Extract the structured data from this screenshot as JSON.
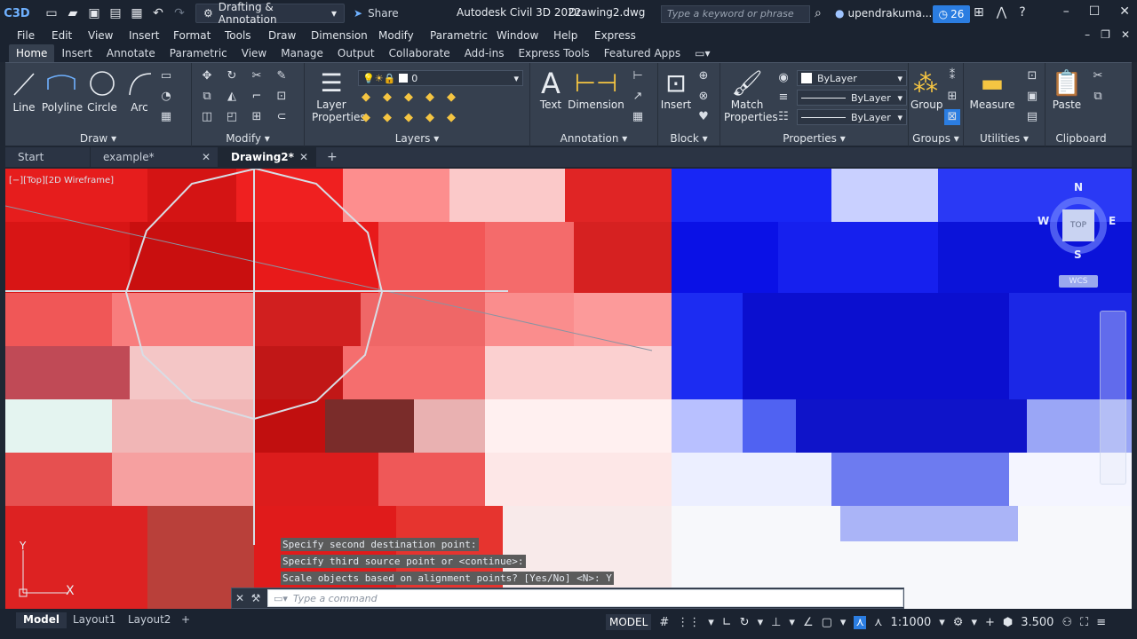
{
  "titlebar": {
    "logo": "C3D",
    "workspace": "Drafting & Annotation",
    "share": "Share",
    "app_name": "Autodesk Civil 3D 2022",
    "file_name": "Drawing2.dwg",
    "search_placeholder": "Type a keyword or phrase",
    "user": "upendrakuma...",
    "clock_count": "26"
  },
  "menu": [
    "File",
    "Edit",
    "View",
    "Insert",
    "Format",
    "Tools",
    "Draw",
    "Dimension",
    "Modify",
    "Parametric",
    "Window",
    "Help",
    "Express"
  ],
  "ribbon_tabs": [
    "Home",
    "Insert",
    "Annotate",
    "Parametric",
    "View",
    "Manage",
    "Output",
    "Collaborate",
    "Add-ins",
    "Express Tools",
    "Featured Apps"
  ],
  "ribbon": {
    "draw": {
      "title": "Draw",
      "tools": [
        "Line",
        "Polyline",
        "Circle",
        "Arc"
      ]
    },
    "modify": {
      "title": "Modify"
    },
    "layers": {
      "title": "Layers",
      "layer_props": [
        "Layer",
        "Properties"
      ],
      "current_layer": "0"
    },
    "annotation": {
      "title": "Annotation",
      "text": "Text",
      "dimension": "Dimension"
    },
    "block": {
      "title": "Block",
      "insert": "Insert"
    },
    "properties": {
      "title": "Properties",
      "match": [
        "Match",
        "Properties"
      ],
      "color": "ByLayer",
      "linetype": "ByLayer",
      "lineweight": "ByLayer"
    },
    "groups": {
      "title": "Groups",
      "group": "Group"
    },
    "utilities": {
      "title": "Utilities",
      "measure": "Measure"
    },
    "clipboard": {
      "title": "Clipboard",
      "paste": "Paste"
    }
  },
  "doc_tabs": [
    "Start",
    "example*",
    "Drawing2*"
  ],
  "viewport": {
    "label": "[−][Top][2D Wireframe]",
    "viewcube": {
      "top": "TOP",
      "n": "N",
      "s": "S",
      "e": "E",
      "w": "W",
      "wcs": "WCS"
    }
  },
  "command_history": [
    "Specify second destination point:",
    "Specify third source point or <continue>:",
    "Scale objects based on alignment points? [Yes/No] <N>: Y"
  ],
  "command_placeholder": "Type a command",
  "ucs": {
    "y": "Y",
    "x": "X"
  },
  "layout_tabs": [
    "Model",
    "Layout1",
    "Layout2"
  ],
  "status": {
    "model": "MODEL",
    "scale": "1:1000",
    "annotation_scale": "3.500"
  }
}
